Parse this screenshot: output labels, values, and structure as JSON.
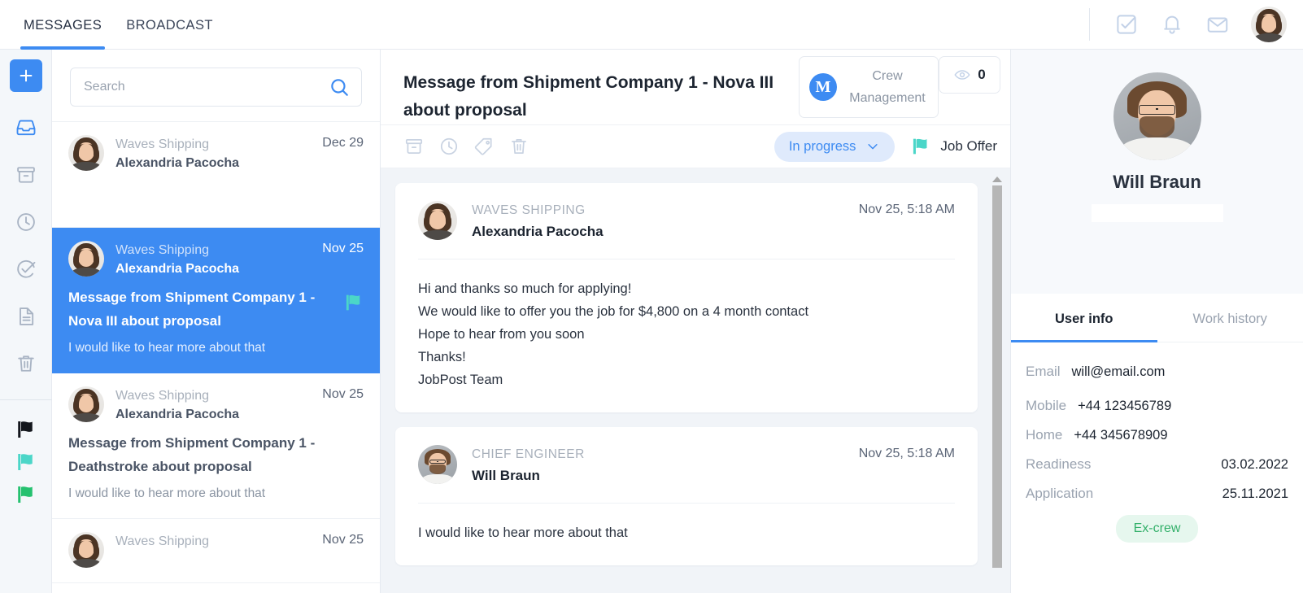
{
  "topnav": {
    "tabs": [
      {
        "label": "MESSAGES",
        "active": true
      },
      {
        "label": "BROADCAST",
        "active": false
      }
    ],
    "icons": [
      "tasks-icon",
      "bell-icon",
      "envelope-icon"
    ],
    "avatar": "user-avatar"
  },
  "rail": {
    "add_label": "+",
    "items": [
      {
        "name": "inbox-icon",
        "active": true
      },
      {
        "name": "archive-icon",
        "active": false
      },
      {
        "name": "clock-icon",
        "active": false
      },
      {
        "name": "check-circle-icon",
        "active": false
      },
      {
        "name": "document-icon",
        "active": false
      },
      {
        "name": "trash-icon",
        "active": false
      }
    ],
    "flags": [
      {
        "name": "flag-black",
        "color": "#13161c"
      },
      {
        "name": "flag-teal",
        "color": "#4bd6c8"
      },
      {
        "name": "flag-green",
        "color": "#25c16f"
      }
    ]
  },
  "search": {
    "value": "",
    "placeholder": "Search",
    "icon": "search-icon"
  },
  "message_list": [
    {
      "company": "Waves Shipping",
      "person": "Alexandria Pacocha",
      "date": "Dec 29",
      "subject": "",
      "preview": "",
      "flag": "",
      "selected": false
    },
    {
      "company": "Waves Shipping",
      "person": "Alexandria Pacocha",
      "date": "Nov 25",
      "subject": "Message from Shipment Company 1 - Nova III about proposal",
      "preview": "I would like to hear more about that",
      "flag": "#4bd6c8",
      "selected": true
    },
    {
      "company": "Waves Shipping",
      "person": "Alexandria Pacocha",
      "date": "Nov 25",
      "subject": "Message from Shipment Company 1 - Deathstroke about proposal",
      "preview": "I would like to hear more about that",
      "flag": "",
      "selected": false
    },
    {
      "company": "Waves Shipping",
      "person": "",
      "date": "Nov 25",
      "subject": "",
      "preview": "",
      "flag": "",
      "selected": false
    }
  ],
  "conversation": {
    "title": "Message from Shipment Company 1 - Nova III about proposal",
    "crew_badge": {
      "logo_letter": "M",
      "label": "Crew Management"
    },
    "views": {
      "icon": "eye-icon",
      "count": "0"
    },
    "toolbar_icons": [
      "archive-icon",
      "clock-icon",
      "tag-icon",
      "trash-icon"
    ],
    "status": {
      "label": "In progress",
      "chevron": "chevron-down-icon"
    },
    "flag": {
      "color": "#4bd6c8",
      "label": "Job Offer"
    },
    "messages": [
      {
        "role": "WAVES SHIPPING",
        "person": "Alexandria Pacocha",
        "time": "Nov 25, 5:18 AM",
        "avatar": "female",
        "body": [
          "Hi and thanks so much for applying!",
          "We would like to offer you the job for $4,800 on a 4 month contact",
          "Hope to hear from you soon",
          "Thanks!",
          "JobPost Team"
        ]
      },
      {
        "role": "CHIEF ENGINEER",
        "person": "Will Braun",
        "time": "Nov 25, 5:18 AM",
        "avatar": "male",
        "body": [
          "I would like to hear more about that"
        ]
      }
    ]
  },
  "right_panel": {
    "profile": {
      "name": "Will Braun",
      "avatar": "male"
    },
    "tabs": [
      {
        "label": "User info",
        "active": true
      },
      {
        "label": "Work history",
        "active": false
      }
    ],
    "info": [
      {
        "label": "Email",
        "value": "will@email.com",
        "spread": false
      },
      {
        "label": "Mobile",
        "value": "+44 123456789",
        "spread": false
      },
      {
        "label": "Home",
        "value": "+44 345678909",
        "spread": false
      },
      {
        "label": "Readiness",
        "value": "03.02.2022",
        "spread": true
      },
      {
        "label": "Application",
        "value": "25.11.2021",
        "spread": true
      }
    ],
    "tag": "Ex-crew"
  }
}
